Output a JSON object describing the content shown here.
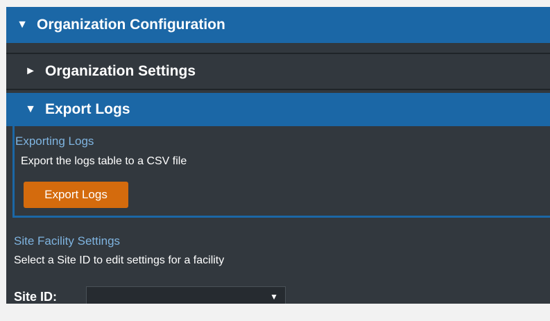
{
  "accordion": {
    "main_title": "Organization Configuration",
    "main_arrow": "▼",
    "settings_title": "Organization Settings",
    "settings_arrow": "►",
    "export_title": "Export Logs",
    "export_arrow": "▼"
  },
  "export_panel": {
    "section_title": "Exporting Logs",
    "description": "Export the logs table to a CSV file",
    "button_label": "Export Logs"
  },
  "site_facility": {
    "section_title": "Site Facility Settings",
    "description": "Select a Site ID to edit settings for a facility",
    "site_label": "Site ID:",
    "selected_value": "",
    "caret": "▼"
  },
  "colors": {
    "header_blue": "#1b67a6",
    "panel_dark": "#32383e",
    "accent_orange": "#d46b0d",
    "link_blue": "#7fb4e0"
  }
}
